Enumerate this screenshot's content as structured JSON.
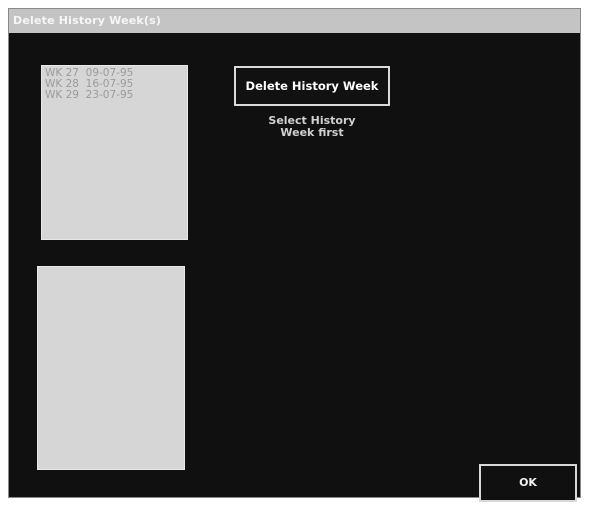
{
  "window": {
    "title": "Delete History Week(s)"
  },
  "history_list": {
    "items": [
      "WK 27  09-07-95",
      "WK 28  16-07-95",
      "WK 29  23-07-95"
    ]
  },
  "actions": {
    "delete_label": "Delete History Week",
    "hint": "Select History\nWeek first",
    "ok_label": "OK"
  },
  "colors": {
    "background": "#101010",
    "listbox": "#d6d6d6",
    "titlebar": "#c4c4c4"
  }
}
